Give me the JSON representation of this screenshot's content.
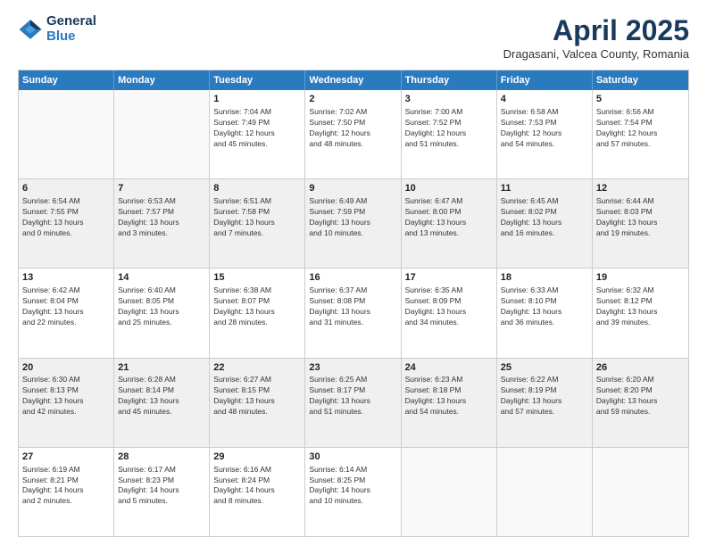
{
  "header": {
    "logo_general": "General",
    "logo_blue": "Blue",
    "month_title": "April 2025",
    "location": "Dragasani, Valcea County, Romania"
  },
  "calendar": {
    "weekdays": [
      "Sunday",
      "Monday",
      "Tuesday",
      "Wednesday",
      "Thursday",
      "Friday",
      "Saturday"
    ],
    "rows": [
      [
        {
          "day": "",
          "empty": true
        },
        {
          "day": "",
          "empty": true
        },
        {
          "day": "1",
          "line1": "Sunrise: 7:04 AM",
          "line2": "Sunset: 7:49 PM",
          "line3": "Daylight: 12 hours",
          "line4": "and 45 minutes."
        },
        {
          "day": "2",
          "line1": "Sunrise: 7:02 AM",
          "line2": "Sunset: 7:50 PM",
          "line3": "Daylight: 12 hours",
          "line4": "and 48 minutes."
        },
        {
          "day": "3",
          "line1": "Sunrise: 7:00 AM",
          "line2": "Sunset: 7:52 PM",
          "line3": "Daylight: 12 hours",
          "line4": "and 51 minutes."
        },
        {
          "day": "4",
          "line1": "Sunrise: 6:58 AM",
          "line2": "Sunset: 7:53 PM",
          "line3": "Daylight: 12 hours",
          "line4": "and 54 minutes."
        },
        {
          "day": "5",
          "line1": "Sunrise: 6:56 AM",
          "line2": "Sunset: 7:54 PM",
          "line3": "Daylight: 12 hours",
          "line4": "and 57 minutes."
        }
      ],
      [
        {
          "day": "6",
          "line1": "Sunrise: 6:54 AM",
          "line2": "Sunset: 7:55 PM",
          "line3": "Daylight: 13 hours",
          "line4": "and 0 minutes."
        },
        {
          "day": "7",
          "line1": "Sunrise: 6:53 AM",
          "line2": "Sunset: 7:57 PM",
          "line3": "Daylight: 13 hours",
          "line4": "and 3 minutes."
        },
        {
          "day": "8",
          "line1": "Sunrise: 6:51 AM",
          "line2": "Sunset: 7:58 PM",
          "line3": "Daylight: 13 hours",
          "line4": "and 7 minutes."
        },
        {
          "day": "9",
          "line1": "Sunrise: 6:49 AM",
          "line2": "Sunset: 7:59 PM",
          "line3": "Daylight: 13 hours",
          "line4": "and 10 minutes."
        },
        {
          "day": "10",
          "line1": "Sunrise: 6:47 AM",
          "line2": "Sunset: 8:00 PM",
          "line3": "Daylight: 13 hours",
          "line4": "and 13 minutes."
        },
        {
          "day": "11",
          "line1": "Sunrise: 6:45 AM",
          "line2": "Sunset: 8:02 PM",
          "line3": "Daylight: 13 hours",
          "line4": "and 16 minutes."
        },
        {
          "day": "12",
          "line1": "Sunrise: 6:44 AM",
          "line2": "Sunset: 8:03 PM",
          "line3": "Daylight: 13 hours",
          "line4": "and 19 minutes."
        }
      ],
      [
        {
          "day": "13",
          "line1": "Sunrise: 6:42 AM",
          "line2": "Sunset: 8:04 PM",
          "line3": "Daylight: 13 hours",
          "line4": "and 22 minutes."
        },
        {
          "day": "14",
          "line1": "Sunrise: 6:40 AM",
          "line2": "Sunset: 8:05 PM",
          "line3": "Daylight: 13 hours",
          "line4": "and 25 minutes."
        },
        {
          "day": "15",
          "line1": "Sunrise: 6:38 AM",
          "line2": "Sunset: 8:07 PM",
          "line3": "Daylight: 13 hours",
          "line4": "and 28 minutes."
        },
        {
          "day": "16",
          "line1": "Sunrise: 6:37 AM",
          "line2": "Sunset: 8:08 PM",
          "line3": "Daylight: 13 hours",
          "line4": "and 31 minutes."
        },
        {
          "day": "17",
          "line1": "Sunrise: 6:35 AM",
          "line2": "Sunset: 8:09 PM",
          "line3": "Daylight: 13 hours",
          "line4": "and 34 minutes."
        },
        {
          "day": "18",
          "line1": "Sunrise: 6:33 AM",
          "line2": "Sunset: 8:10 PM",
          "line3": "Daylight: 13 hours",
          "line4": "and 36 minutes."
        },
        {
          "day": "19",
          "line1": "Sunrise: 6:32 AM",
          "line2": "Sunset: 8:12 PM",
          "line3": "Daylight: 13 hours",
          "line4": "and 39 minutes."
        }
      ],
      [
        {
          "day": "20",
          "line1": "Sunrise: 6:30 AM",
          "line2": "Sunset: 8:13 PM",
          "line3": "Daylight: 13 hours",
          "line4": "and 42 minutes."
        },
        {
          "day": "21",
          "line1": "Sunrise: 6:28 AM",
          "line2": "Sunset: 8:14 PM",
          "line3": "Daylight: 13 hours",
          "line4": "and 45 minutes."
        },
        {
          "day": "22",
          "line1": "Sunrise: 6:27 AM",
          "line2": "Sunset: 8:15 PM",
          "line3": "Daylight: 13 hours",
          "line4": "and 48 minutes."
        },
        {
          "day": "23",
          "line1": "Sunrise: 6:25 AM",
          "line2": "Sunset: 8:17 PM",
          "line3": "Daylight: 13 hours",
          "line4": "and 51 minutes."
        },
        {
          "day": "24",
          "line1": "Sunrise: 6:23 AM",
          "line2": "Sunset: 8:18 PM",
          "line3": "Daylight: 13 hours",
          "line4": "and 54 minutes."
        },
        {
          "day": "25",
          "line1": "Sunrise: 6:22 AM",
          "line2": "Sunset: 8:19 PM",
          "line3": "Daylight: 13 hours",
          "line4": "and 57 minutes."
        },
        {
          "day": "26",
          "line1": "Sunrise: 6:20 AM",
          "line2": "Sunset: 8:20 PM",
          "line3": "Daylight: 13 hours",
          "line4": "and 59 minutes."
        }
      ],
      [
        {
          "day": "27",
          "line1": "Sunrise: 6:19 AM",
          "line2": "Sunset: 8:21 PM",
          "line3": "Daylight: 14 hours",
          "line4": "and 2 minutes."
        },
        {
          "day": "28",
          "line1": "Sunrise: 6:17 AM",
          "line2": "Sunset: 8:23 PM",
          "line3": "Daylight: 14 hours",
          "line4": "and 5 minutes."
        },
        {
          "day": "29",
          "line1": "Sunrise: 6:16 AM",
          "line2": "Sunset: 8:24 PM",
          "line3": "Daylight: 14 hours",
          "line4": "and 8 minutes."
        },
        {
          "day": "30",
          "line1": "Sunrise: 6:14 AM",
          "line2": "Sunset: 8:25 PM",
          "line3": "Daylight: 14 hours",
          "line4": "and 10 minutes."
        },
        {
          "day": "",
          "empty": true
        },
        {
          "day": "",
          "empty": true
        },
        {
          "day": "",
          "empty": true
        }
      ]
    ]
  }
}
